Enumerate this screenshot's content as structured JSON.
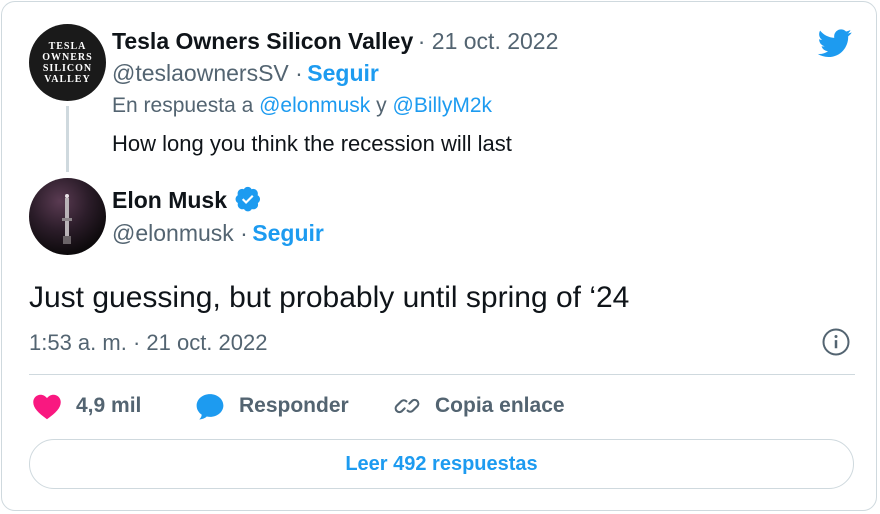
{
  "colors": {
    "accent": "#1d9bf0",
    "like": "#f91880",
    "muted": "#536471",
    "text": "#0f1419",
    "border": "#cfd9de"
  },
  "quoted_tweet": {
    "avatar_text": "TESLA\nOWNERS\nSILICON\nVALLEY",
    "author_name": "Tesla Owners Silicon Valley",
    "date": "· 21 oct. 2022",
    "handle": "@teslaownersSV ·",
    "follow_label": "Seguir",
    "reply_prefix": "En respuesta a",
    "reply_user_1": "@elonmusk",
    "reply_joiner": "y",
    "reply_user_2": "@BillyM2k",
    "text": "How long you think the recession will last"
  },
  "main_tweet": {
    "author_name": "Elon Musk",
    "handle": "@elonmusk ·",
    "follow_label": "Seguir",
    "text": "Just guessing, but probably until spring of ‘24",
    "timestamp": "1:53 a. m. · 21 oct. 2022"
  },
  "actions": {
    "likes": "4,9 mil",
    "reply_label": "Responder",
    "copy_link_label": "Copia enlace"
  },
  "read_replies_label": "Leer 492 respuestas",
  "icons": [
    "twitter-bird-icon",
    "verified-badge-icon",
    "info-icon",
    "heart-icon",
    "reply-bubble-icon",
    "link-icon"
  ]
}
